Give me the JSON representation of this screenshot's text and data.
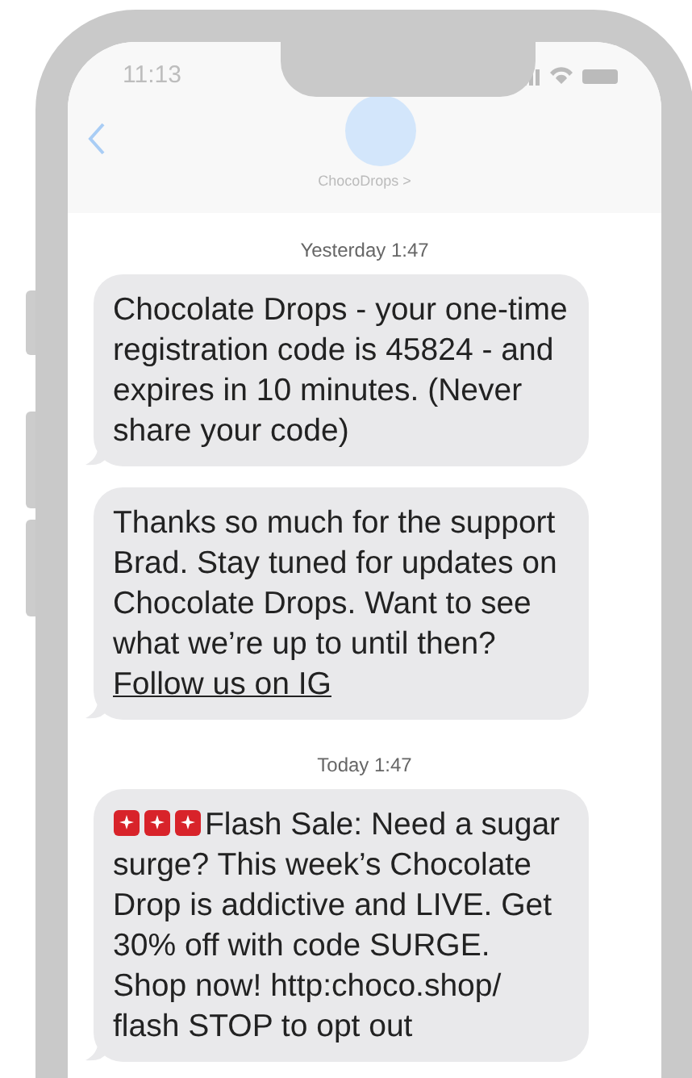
{
  "status_bar": {
    "time": "11:13"
  },
  "contact": {
    "name": "ChocoDrops >"
  },
  "groups": [
    {
      "date": "Yesterday 1:47",
      "messages": [
        {
          "kind": "plain",
          "text": "Chocolate Drops - your one-time registration code is 45824 - and expires in 10 minutes. (Never share your code)"
        },
        {
          "kind": "plain",
          "text": "Thanks so much for the support Brad. Stay tuned for updates on Chocolate Drops. Want to see what we’re up to until then?",
          "link": "Follow us on IG"
        }
      ]
    },
    {
      "date": "Today 1:47",
      "messages": [
        {
          "kind": "promo",
          "text": "Flash Sale: Need a sugar surge? This week’s Chocolate Drop is addictive and LIVE. Get 30% off with code SURGE. Shop now! http:choco.shop/ flash STOP to opt out"
        }
      ]
    }
  ]
}
